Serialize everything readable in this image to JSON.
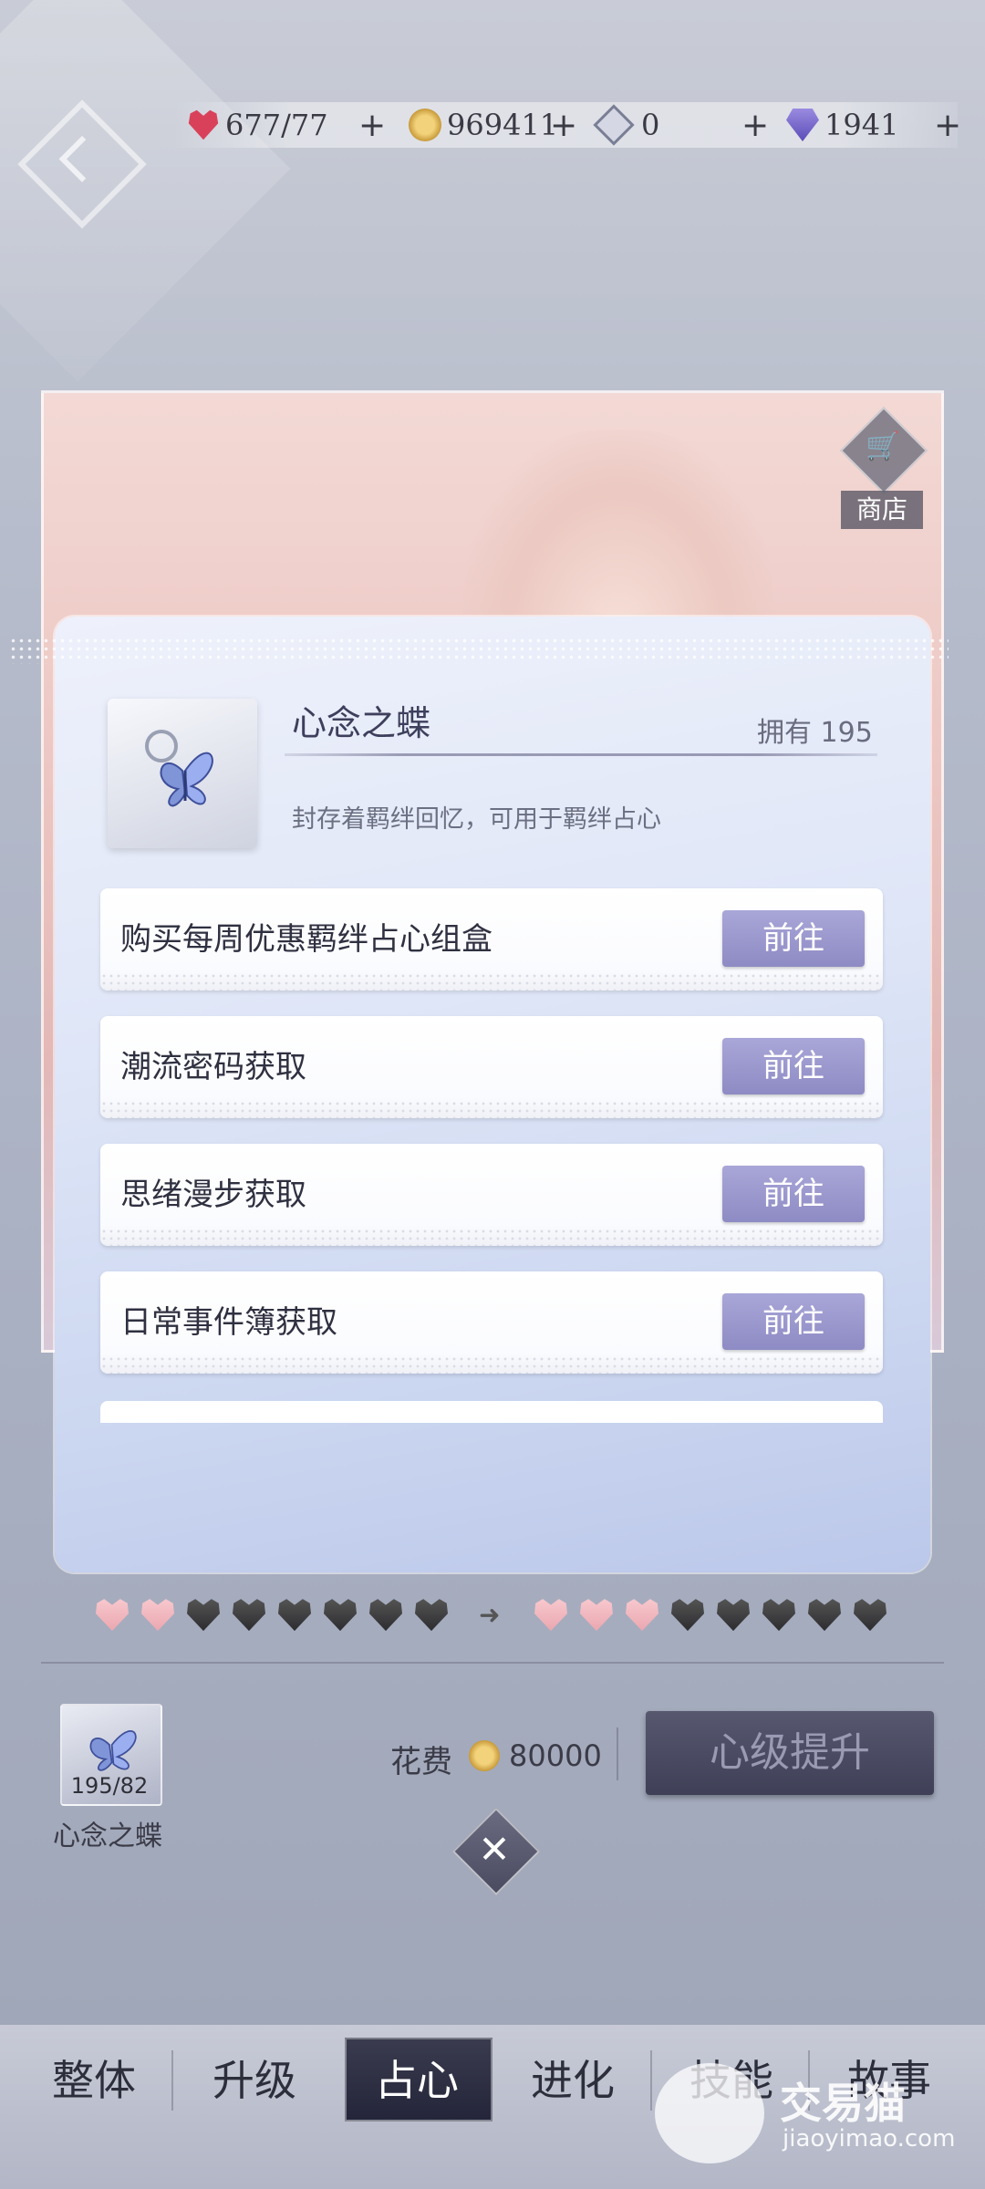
{
  "resources": [
    {
      "icon": "heart-icon",
      "value": "677/77"
    },
    {
      "icon": "coin-icon",
      "value": "969411"
    },
    {
      "icon": "crystal-icon",
      "value": "0"
    },
    {
      "icon": "diamond-icon",
      "value": "1941"
    }
  ],
  "plus_label": "+",
  "shop": {
    "label": "商店"
  },
  "modal": {
    "item_name": "心念之蝶",
    "owned": "拥有 195",
    "description": "封存着羁绊回忆，可用于羁绊占心",
    "rows": [
      {
        "label": "购买每周优惠羁绊占心组盒",
        "button": "前往"
      },
      {
        "label": "潮流密码获取",
        "button": "前往"
      },
      {
        "label": "思绪漫步获取",
        "button": "前往"
      },
      {
        "label": "日常事件簿获取",
        "button": "前往"
      }
    ]
  },
  "hearts": {
    "current_filled": 2,
    "next_filled": 3,
    "total": 8
  },
  "cost": {
    "material_count": "195/82",
    "material_name": "心念之蝶",
    "label": "花费",
    "amount": "80000",
    "upgrade_button": "心级提升"
  },
  "close_symbol": "✕",
  "nav": {
    "items": [
      "整体",
      "升级",
      "占心",
      "进化",
      "技能",
      "故事"
    ],
    "active": "占心"
  },
  "watermark": {
    "name": "交易猫",
    "url": "jiaoyimao.com"
  }
}
